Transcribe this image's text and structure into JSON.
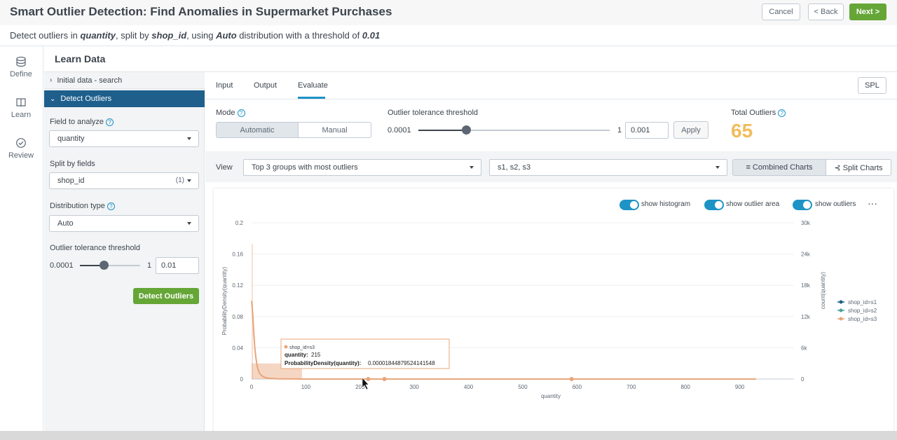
{
  "header": {
    "title": "Smart Outlier Detection: Find Anomalies in Supermarket Purchases",
    "cancel": "Cancel",
    "back": "< Back",
    "next": "Next >"
  },
  "description": {
    "p1": "Detect outliers in ",
    "field": "quantity",
    "p2": ", split by ",
    "split": "shop_id",
    "p3": ", using ",
    "dist": "Auto",
    "p4": " distribution with a threshold of ",
    "threshold": "0.01"
  },
  "nav": {
    "define": "Define",
    "learn": "Learn",
    "review": "Review"
  },
  "section_title": "Learn Data",
  "left_panel": {
    "step1": "Initial data - search",
    "step2": "Detect Outliers",
    "field_label": "Field to analyze",
    "field_value": "quantity",
    "split_label": "Split by fields",
    "split_value": "shop_id",
    "split_count": "(1)",
    "dist_label": "Distribution type",
    "dist_value": "Auto",
    "thr_label": "Outlier tolerance threshold",
    "thr_min": "0.0001",
    "thr_max": "1",
    "thr_value": "0.01",
    "thr_level": 0.4,
    "detect_button": "Detect Outliers"
  },
  "tabs": {
    "input": "Input",
    "output": "Output",
    "evaluate": "Evaluate",
    "spl": "SPL"
  },
  "mode": {
    "label": "Mode",
    "automatic": "Automatic",
    "manual": "Manual"
  },
  "threshold": {
    "label": "Outlier tolerance threshold",
    "min": "0.0001",
    "max": "1",
    "value": "0.001",
    "level": 0.25,
    "apply": "Apply"
  },
  "total_outliers": {
    "label": "Total Outliers",
    "value": "65"
  },
  "view": {
    "label": "View",
    "groups": "Top 3 groups with most outliers",
    "shops": "s1, s2, s3",
    "combined": "≡ Combined Charts",
    "split": "⊰ Split Charts"
  },
  "toggles": {
    "histogram": "show histogram",
    "outlier_area": "show outlier area",
    "outliers": "show outliers",
    "more": "···"
  },
  "tooltip": {
    "series": "shop_id=s3",
    "line1_label": "quantity:",
    "line1_value": "215",
    "line2_label": "ProbabilityDensity(quantity):",
    "line2_value": "0.00001844879524141548"
  },
  "chart_data": {
    "type": "line",
    "xlabel": "quantity",
    "ylabel": "ProbabilityDensity(quantity)",
    "y2label": "count(quantity)",
    "xlim": [
      0,
      1000
    ],
    "ylim": [
      0,
      0.2
    ],
    "y2lim": [
      0,
      30000
    ],
    "x_ticks": [
      "0",
      "100",
      "200",
      "300",
      "400",
      "500",
      "600",
      "700",
      "800",
      "900"
    ],
    "y_ticks": [
      "0",
      "0.04",
      "0.08",
      "0.12",
      "0.16",
      "0.2"
    ],
    "y2_ticks": [
      "0",
      "6k",
      "12k",
      "18k",
      "24k",
      "30k"
    ],
    "series": [
      {
        "name": "shop_id=s1",
        "color": "#1a5e8a"
      },
      {
        "name": "shop_id=s2",
        "color": "#4aa39a"
      },
      {
        "name": "shop_id=s3",
        "color": "#e8a57a"
      }
    ],
    "density_s3": {
      "x": [
        0,
        2,
        4,
        6,
        8,
        10,
        12,
        15,
        20,
        25,
        30,
        40,
        50,
        60,
        80,
        100,
        150,
        200,
        300,
        500,
        930
      ],
      "y": [
        0.1,
        0.085,
        0.06,
        0.04,
        0.027,
        0.018,
        0.012,
        0.007,
        0.0035,
        0.002,
        0.0012,
        0.0006,
        0.0003,
        0.00015,
        6e-05,
        3e-05,
        2e-05,
        2e-05,
        1e-05,
        1e-05,
        5e-06
      ]
    },
    "histogram_s3_max_x": 93,
    "histogram_s3_count": 3000,
    "outliers_s3": [
      215,
      245,
      590
    ]
  }
}
